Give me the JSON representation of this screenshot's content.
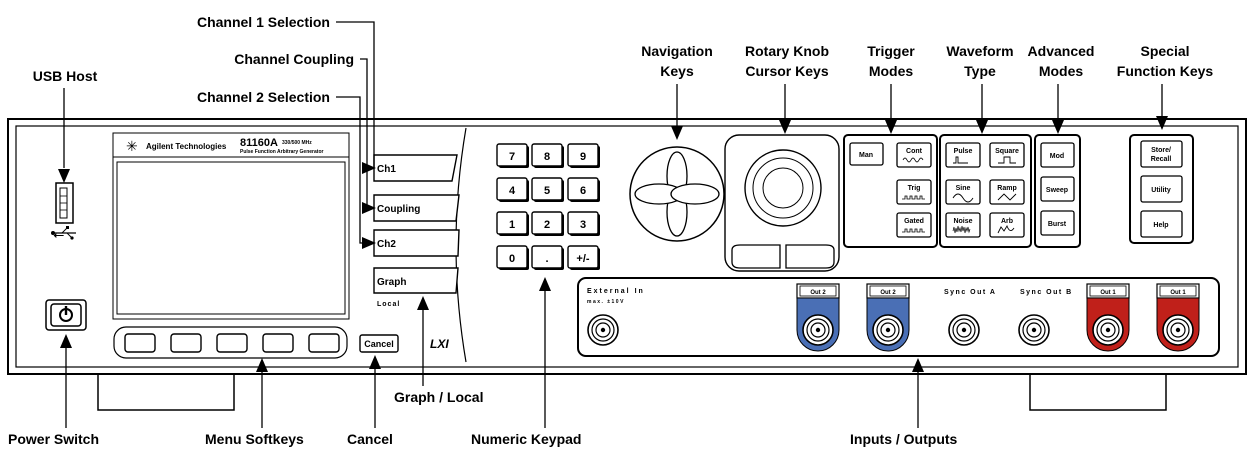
{
  "labels": {
    "channel1_selection": "Channel 1 Selection",
    "channel_coupling": "Channel Coupling",
    "channel2_selection": "Channel 2 Selection",
    "usb_host": "USB Host",
    "navigation_keys_1": "Navigation",
    "navigation_keys_2": "Keys",
    "rotary_knob_1": "Rotary Knob",
    "rotary_knob_2": "Cursor Keys",
    "trigger_modes_1": "Trigger",
    "trigger_modes_2": "Modes",
    "waveform_type_1": "Waveform",
    "waveform_type_2": "Type",
    "advanced_modes_1": "Advanced",
    "advanced_modes_2": "Modes",
    "special_function_1": "Special",
    "special_function_2": "Function Keys",
    "graph_local": "Graph / Local",
    "power_switch": "Power Switch",
    "menu_softkeys": "Menu Softkeys",
    "cancel": "Cancel",
    "numeric_keypad": "Numeric Keypad",
    "inputs_outputs": "Inputs / Outputs"
  },
  "instrument": {
    "brand": "Agilent Technologies",
    "model": "81160A",
    "spec": "330/500 MHz",
    "subtitle": "Pulse Function Arbitrary Generator",
    "lxi": "LXI",
    "local": "Local"
  },
  "buttons": {
    "ch1": "Ch1",
    "coupling": "Coupling",
    "ch2": "Ch2",
    "graph": "Graph",
    "cancel": "Cancel",
    "keypad": [
      "7",
      "8",
      "9",
      "4",
      "5",
      "6",
      "1",
      "2",
      "3",
      "0",
      ".",
      "+/-"
    ],
    "man": "Man",
    "cont": "Cont",
    "trig": "Trig",
    "gated": "Gated",
    "pulse": "Pulse",
    "square": "Square",
    "sine": "Sine",
    "ramp": "Ramp",
    "noise": "Noise",
    "arb": "Arb",
    "mod": "Mod",
    "sweep": "Sweep",
    "burst": "Burst",
    "store_recall_1": "Store/",
    "store_recall_2": "Recall",
    "utility": "Utility",
    "help": "Help"
  },
  "connectors": {
    "external_in": "External In",
    "external_in_max": "max. ±10V",
    "out2": "Out 2",
    "out1": "Out 1",
    "sync_out_a": "Sync Out A",
    "sync_out_b": "Sync Out B"
  },
  "colors": {
    "out1_ring": "#c0201a",
    "out2_ring": "#4a6fb5"
  }
}
